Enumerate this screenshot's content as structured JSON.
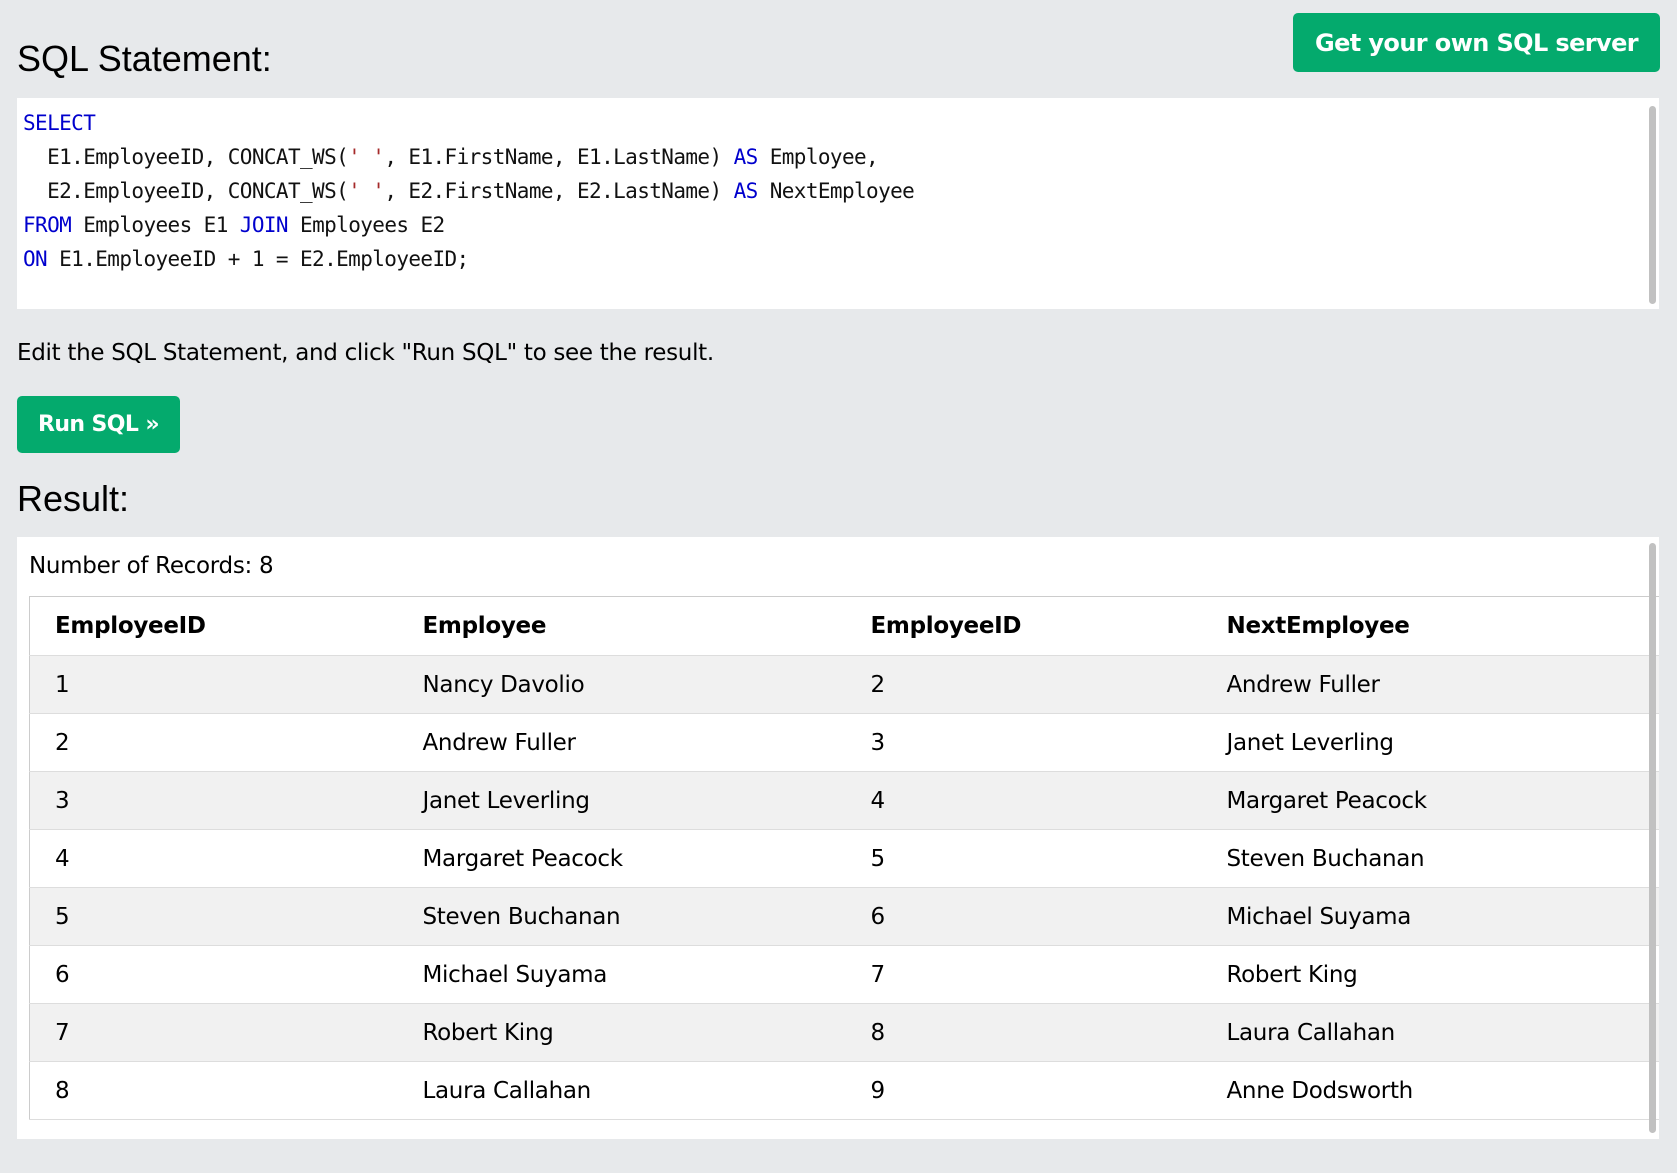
{
  "header": {
    "title": "SQL Statement:",
    "get_server_label": "Get your own SQL server"
  },
  "editor": {
    "lines": [
      [
        {
          "t": "SELECT",
          "c": "kw"
        }
      ],
      [
        {
          "t": "  E1.EmployeeID, CONCAT_WS(",
          "c": ""
        },
        {
          "t": "' '",
          "c": "str"
        },
        {
          "t": ", E1.FirstName, E1.LastName) ",
          "c": ""
        },
        {
          "t": "AS",
          "c": "kw"
        },
        {
          "t": " Employee,",
          "c": ""
        }
      ],
      [
        {
          "t": "  E2.EmployeeID, CONCAT_WS(",
          "c": ""
        },
        {
          "t": "' '",
          "c": "str"
        },
        {
          "t": ", E2.FirstName, E2.LastName) ",
          "c": ""
        },
        {
          "t": "AS",
          "c": "kw"
        },
        {
          "t": " NextEmployee",
          "c": ""
        }
      ],
      [
        {
          "t": "FROM",
          "c": "kw"
        },
        {
          "t": " Employees E1 ",
          "c": ""
        },
        {
          "t": "JOIN",
          "c": "kw"
        },
        {
          "t": " Employees E2",
          "c": ""
        }
      ],
      [
        {
          "t": "ON",
          "c": "kw"
        },
        {
          "t": " E1.EmployeeID + 1 = E2.EmployeeID;",
          "c": ""
        }
      ]
    ]
  },
  "hint_text": "Edit the SQL Statement, and click \"Run SQL\" to see the result.",
  "run_button_label": "Run SQL »",
  "result": {
    "title": "Result:",
    "record_count": "Number of Records: 8",
    "columns": [
      "EmployeeID",
      "Employee",
      "EmployeeID",
      "NextEmployee"
    ],
    "rows": [
      [
        "1",
        "Nancy Davolio",
        "2",
        "Andrew Fuller"
      ],
      [
        "2",
        "Andrew Fuller",
        "3",
        "Janet Leverling"
      ],
      [
        "3",
        "Janet Leverling",
        "4",
        "Margaret Peacock"
      ],
      [
        "4",
        "Margaret Peacock",
        "5",
        "Steven Buchanan"
      ],
      [
        "5",
        "Steven Buchanan",
        "6",
        "Michael Suyama"
      ],
      [
        "6",
        "Michael Suyama",
        "7",
        "Robert King"
      ],
      [
        "7",
        "Robert King",
        "8",
        "Laura Callahan"
      ],
      [
        "8",
        "Laura Callahan",
        "9",
        "Anne Dodsworth"
      ]
    ]
  },
  "colors": {
    "accent": "#04aa6d",
    "background": "#e7e9eb",
    "keyword": "#0000cd",
    "string": "#a52a2a"
  }
}
